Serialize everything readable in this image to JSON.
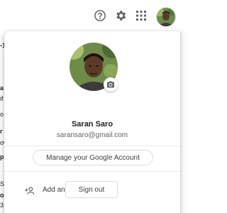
{
  "topbar": {
    "help_icon": "help-circle-icon",
    "settings_icon": "gear-icon",
    "apps_icon": "apps-grid-icon",
    "avatar_icon": "profile-photo"
  },
  "account": {
    "name": "Saran Saro",
    "email": "saransaro@gmail.com",
    "manage_label": "Manage your Google Account",
    "add_account_label": "Add another account",
    "sign_out_label": "Sign out",
    "camera_icon": "camera-icon"
  },
  "background": {
    "fragments": [
      "-1",
      "a",
      "if",
      "o",
      "r",
      "ow",
      "p",
      "S",
      "ow",
      "3"
    ]
  },
  "colors": {
    "accent_border": "#dadce0",
    "text_primary": "#202124",
    "text_secondary": "#5f6368"
  }
}
